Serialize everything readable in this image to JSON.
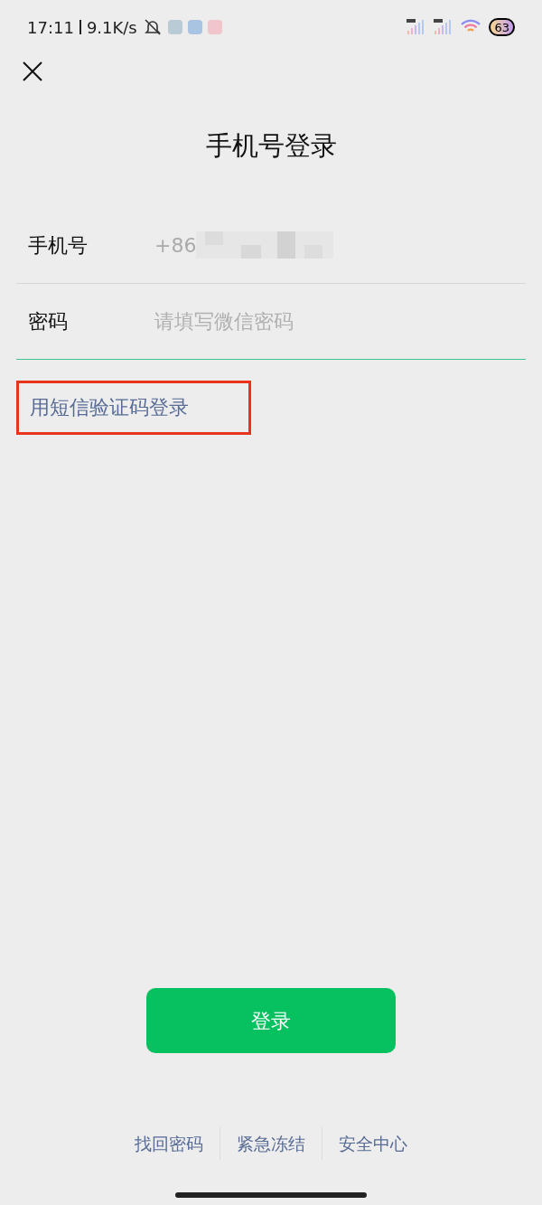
{
  "status_bar": {
    "time": "17:11",
    "speed": "9.1K/s",
    "battery": "63"
  },
  "title": "手机号登录",
  "phone": {
    "label": "手机号",
    "value": "+86"
  },
  "password": {
    "label": "密码",
    "placeholder": "请填写微信密码",
    "focused": true
  },
  "sms_link": {
    "label": "用短信验证码登录",
    "highlighted": true
  },
  "login_button": "登录",
  "footer_links": [
    "找回密码",
    "紧急冻结",
    "安全中心"
  ]
}
